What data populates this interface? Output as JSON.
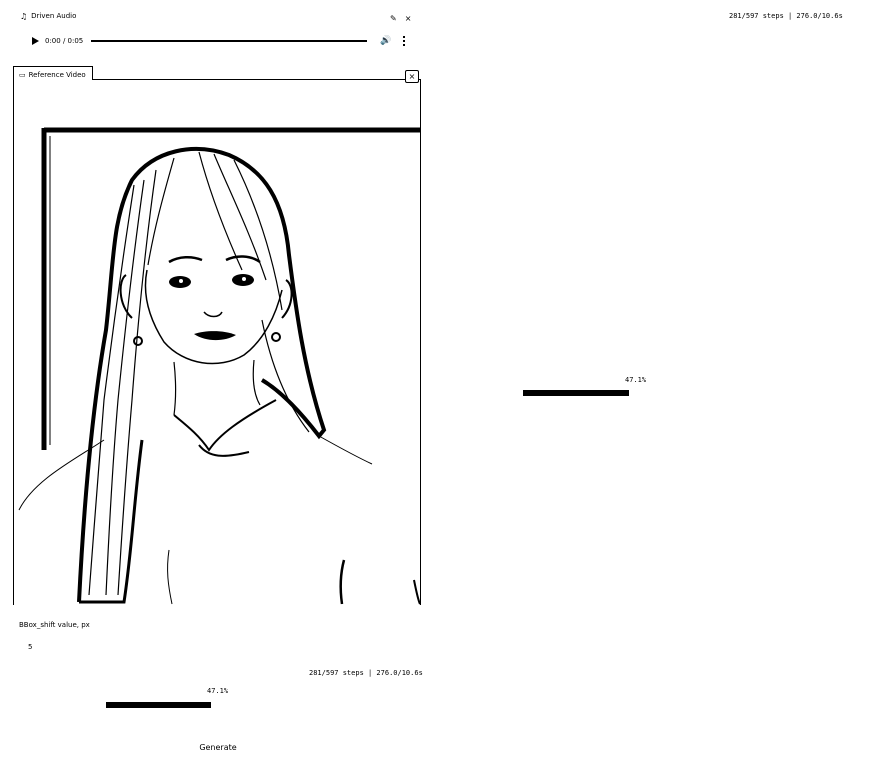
{
  "audio": {
    "title": "Driven Audio",
    "icon": "music-note-icon",
    "time": "0:00 / 0:05",
    "progress": 0
  },
  "video": {
    "tab_label": "Reference Video",
    "clear_symbol": "×"
  },
  "bbox": {
    "label": "BBox_shift value, px",
    "value": "5"
  },
  "progress": {
    "status": "281/597 steps | 276.0/10.6s",
    "percent_label": "47.1%",
    "fraction": 0.471
  },
  "generate_label": "Generate",
  "colors": {
    "ink": "#000000",
    "background": "#ffffff"
  }
}
